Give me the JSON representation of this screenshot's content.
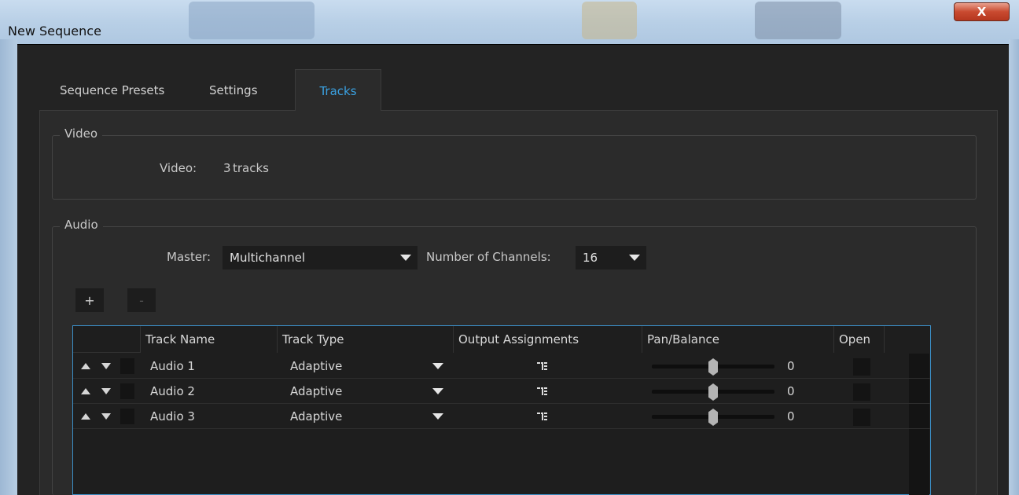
{
  "window": {
    "title": "New Sequence",
    "close_label": "X"
  },
  "tabs": [
    {
      "label": "Sequence Presets"
    },
    {
      "label": "Settings"
    },
    {
      "label": "Tracks",
      "active": true
    }
  ],
  "video": {
    "group_label": "Video",
    "label": "Video:",
    "count": "3",
    "unit": "tracks"
  },
  "audio": {
    "group_label": "Audio",
    "master_label": "Master:",
    "master_value": "Multichannel",
    "channels_label": "Number of Channels:",
    "channels_value": "16",
    "add_label": "+",
    "remove_label": "-"
  },
  "table": {
    "headers": [
      "Track Name",
      "Track Type",
      "Output Assignments",
      "Pan/Balance",
      "Open"
    ],
    "rows": [
      {
        "name": "Audio 1",
        "type": "Adaptive",
        "pan": "0",
        "pan_level": 0.5
      },
      {
        "name": "Audio 2",
        "type": "Adaptive",
        "pan": "0",
        "pan_level": 0.5
      },
      {
        "name": "Audio 3",
        "type": "Adaptive",
        "pan": "0",
        "pan_level": 0.5
      }
    ]
  },
  "colors": {
    "accent": "#3aa0e0",
    "panel": "#2b2b2b",
    "table_border": "#3c8fc7"
  }
}
